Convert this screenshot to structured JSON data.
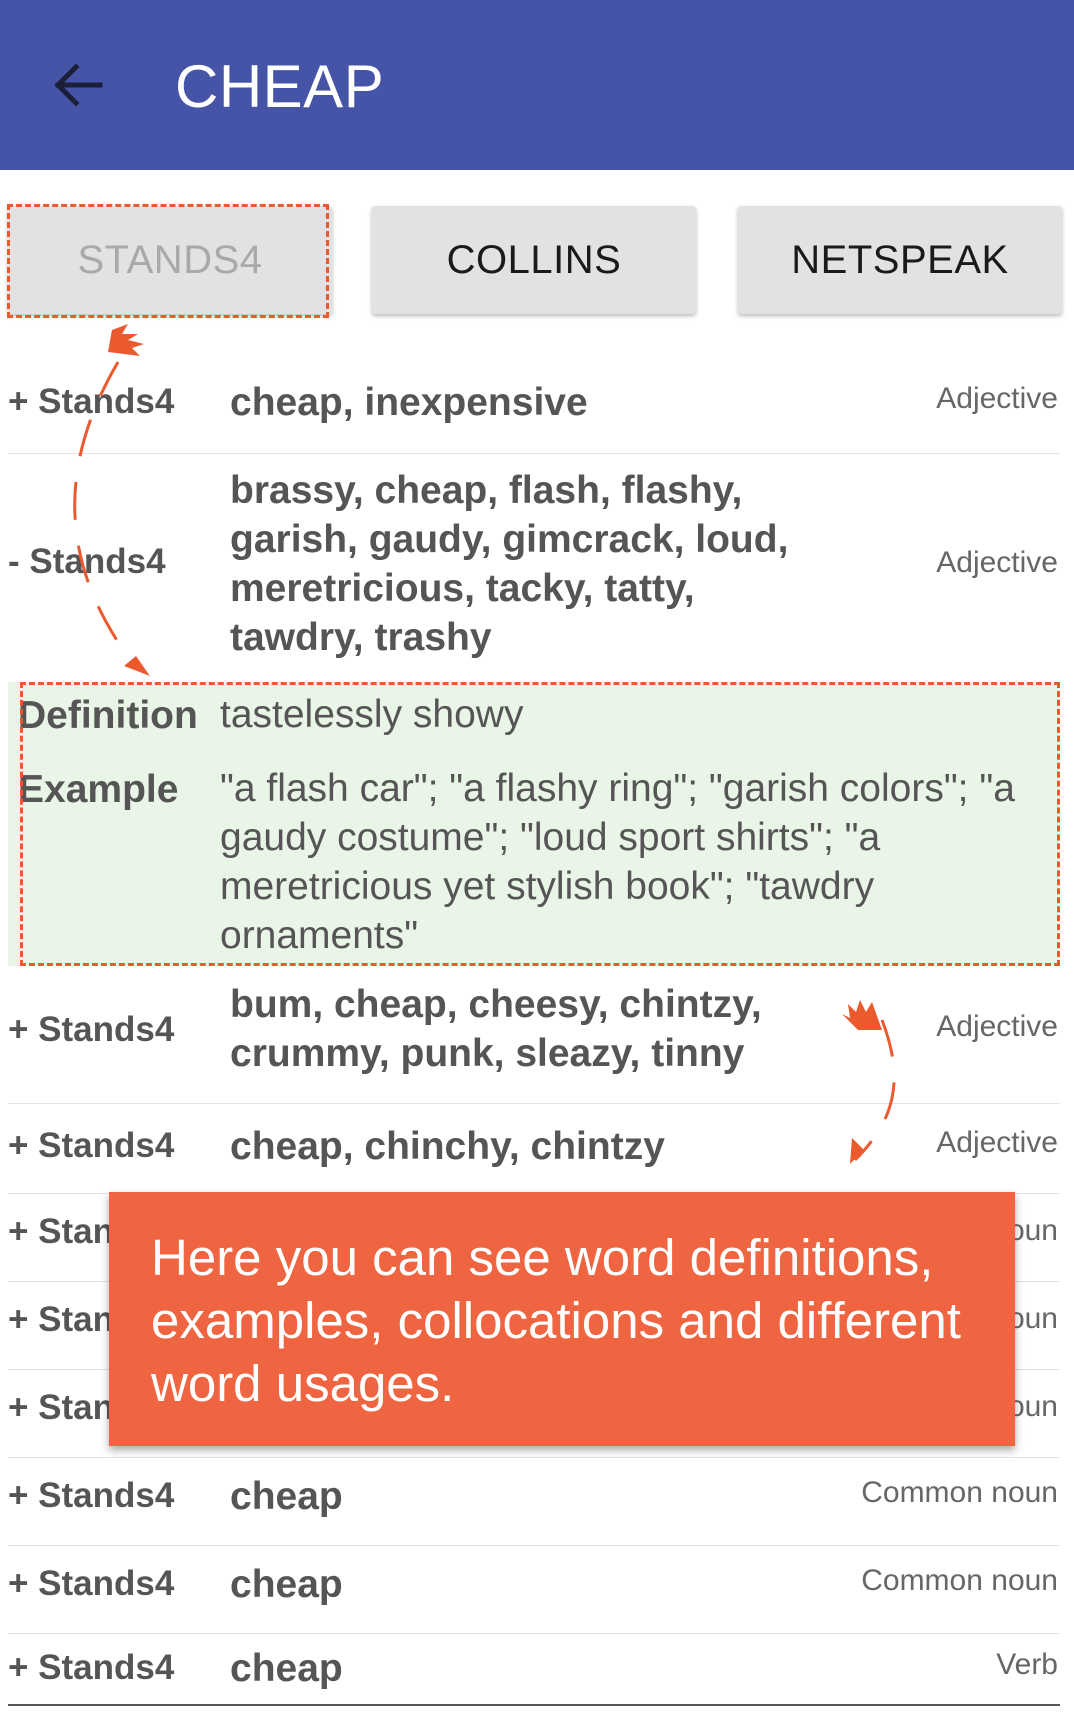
{
  "app_bar": {
    "title": "CHEAP",
    "back_icon": "arrow-left-icon",
    "color": "#4654a7"
  },
  "tabs": [
    {
      "label": "STANDS4",
      "active": true
    },
    {
      "label": "COLLINS",
      "active": false
    },
    {
      "label": "NETSPEAK",
      "active": false
    }
  ],
  "rows": [
    {
      "toggle_source": "+ Stands4",
      "words": "cheap, inexpensive",
      "pos": "Adjective"
    },
    {
      "toggle_source": "- Stands4",
      "words": "brassy, cheap, flash, flashy, garish, gaudy, gimcrack, loud, meretricious, tacky, tatty, tawdry, trashy",
      "pos": "Adjective"
    },
    {
      "toggle_source": "+ Stands4",
      "words": "bum, cheap, cheesy, chintzy, crummy, punk, sleazy, tinny",
      "pos": "Adjective"
    },
    {
      "toggle_source": "+ Stands4",
      "words": "cheap, chinchy, chintzy",
      "pos": "Adjective"
    },
    {
      "toggle_source": "+ Stan",
      "words": "",
      "pos": "oun"
    },
    {
      "toggle_source": "+ Stan",
      "words": "",
      "pos": "oun"
    },
    {
      "toggle_source": "+ Stan",
      "words": "",
      "pos": "oun"
    },
    {
      "toggle_source": "+ Stands4",
      "words": "cheap",
      "pos": "Common noun"
    },
    {
      "toggle_source": "+ Stands4",
      "words": "cheap",
      "pos": "Common noun"
    },
    {
      "toggle_source": "+ Stands4",
      "words": "cheap",
      "pos": "Verb"
    }
  ],
  "definition": {
    "definition_label": "Definition",
    "definition_text": "tastelessly showy",
    "example_label": "Example",
    "example_text": "\"a flash car\"; \"a flashy ring\"; \"garish colors\"; \"a gaudy costume\"; \"loud sport shirts\"; \"a meretricious yet stylish book\"; \"tawdry ornaments\""
  },
  "tooltip": {
    "text": "Here you can see word definitions, examples, collocations and different word usages.",
    "color": "#ef6541"
  },
  "highlight_color": "#ea5a2e"
}
